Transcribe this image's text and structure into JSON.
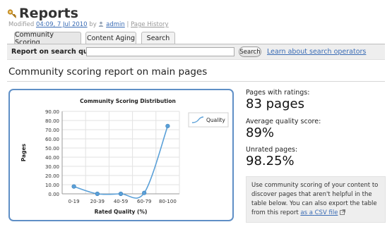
{
  "header": {
    "title": "Reports",
    "title_icon": "key-icon",
    "meta_prefix": "Modified",
    "modified_date": "04:09, 7 Jul 2010",
    "by_text": "by",
    "author": "admin",
    "separator": "|",
    "history_link": "Page History"
  },
  "tabs": [
    {
      "label": "Community Scoring",
      "active": true
    },
    {
      "label": "Content Aging",
      "active": false
    },
    {
      "label": "Search",
      "active": false
    }
  ],
  "search": {
    "label": "Report on search query:",
    "value": "",
    "placeholder": "",
    "button_label": "Search",
    "help_link": "Learn about search operators"
  },
  "report": {
    "heading": "Community scoring report on main pages"
  },
  "stats": {
    "pages_with_ratings_label": "Pages with ratings:",
    "pages_with_ratings_value": "83 pages",
    "avg_quality_label": "Average quality score:",
    "avg_quality_value": "89%",
    "unrated_label": "Unrated pages:",
    "unrated_value": "98.25%"
  },
  "info": {
    "text": "Use community scoring of your content to discover pages that aren't helpful in the table below. You can also export the table from this report",
    "link_prefix": "as a",
    "link_text": "CSV file"
  },
  "colors": {
    "accent": "#5f8fc6",
    "link": "#3a6cb5",
    "series": "#5aa0d8"
  },
  "chart_data": {
    "type": "line",
    "title": "Community Scoring Distribution",
    "xlabel": "Rated Quality (%)",
    "ylabel": "Pages",
    "categories": [
      "0-19",
      "20-39",
      "40-59",
      "60-79",
      "80-100"
    ],
    "series": [
      {
        "name": "Quality",
        "values": [
          8,
          0,
          0,
          1,
          74
        ]
      }
    ],
    "ylim": [
      0,
      90
    ],
    "yticks": [
      "0.00",
      "10.00",
      "20.00",
      "30.00",
      "40.00",
      "50.00",
      "60.00",
      "70.00",
      "80.00",
      "90.00"
    ],
    "grid": true,
    "legend": "top-right"
  }
}
